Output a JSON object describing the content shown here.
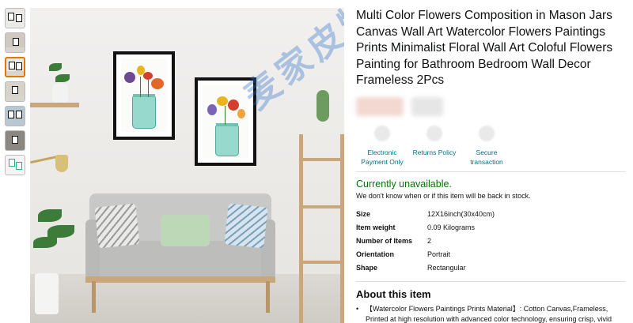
{
  "product": {
    "title": "Multi Color Flowers Composition in Mason Jars Canvas Wall Art Watercolor Flowers Paintings Prints Minimalist Floral Wall Art Coloful Flowers Painting for Bathroom Bedroom Wall Decor Frameless 2Pcs"
  },
  "watermark": "麦家皮特",
  "badges": [
    {
      "label": "Electronic Payment Only"
    },
    {
      "label": "Returns Policy"
    },
    {
      "label": "Secure transaction"
    }
  ],
  "availability": {
    "status": "Currently unavailable.",
    "note": "We don't know when or if this item will be back in stock."
  },
  "specs": [
    {
      "key": "Size",
      "value": "12X16inch(30x40cm)"
    },
    {
      "key": "Item weight",
      "value": "0.09 Kilograms"
    },
    {
      "key": "Number of Items",
      "value": "2"
    },
    {
      "key": "Orientation",
      "value": "Portrait"
    },
    {
      "key": "Shape",
      "value": "Rectangular"
    }
  ],
  "about": {
    "title": "About this item",
    "bullets": [
      "【Watercolor Flowers Paintings Prints Material】: Cotton Canvas,Frameless, Printed at high resolution with advanced color technology, ensuring crisp, vivid images every time, and is water and fade resistant."
    ]
  },
  "colors": {
    "link": "#007185",
    "available": "#007600",
    "thumb_active": "#e77600"
  },
  "thumbnails": [
    {
      "icon": "thumbnail-image-icon"
    },
    {
      "icon": "thumbnail-image-icon"
    },
    {
      "icon": "thumbnail-image-icon"
    },
    {
      "icon": "thumbnail-image-icon"
    },
    {
      "icon": "thumbnail-image-icon"
    },
    {
      "icon": "thumbnail-image-icon"
    },
    {
      "icon": "thumbnail-image-icon"
    }
  ]
}
